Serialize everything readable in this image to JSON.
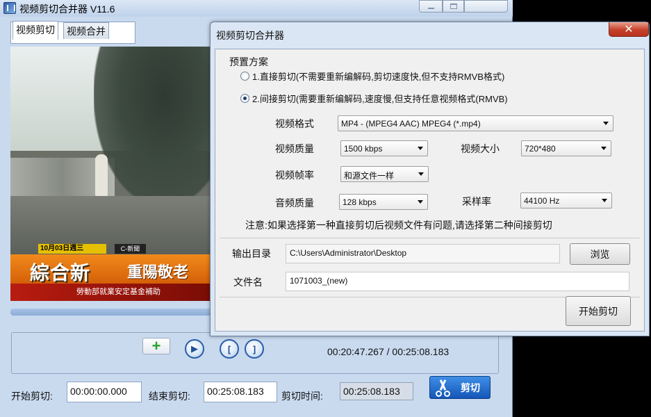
{
  "main_window": {
    "title": "视频剪切合并器 V11.6",
    "tabs": [
      {
        "label": "视频剪切"
      },
      {
        "label": "视频合并"
      }
    ],
    "video_overlay": {
      "date": "10月03日週三",
      "channel": "C-新聞",
      "logo": "綜合新",
      "headline": "重陽敬老",
      "ticker": "勞動部就業安定基金補助"
    },
    "controls": {
      "add_icon": "plus-icon",
      "play_icon": "play-icon",
      "time_display": "00:20:47.267 / 00:25:08.183"
    },
    "cut": {
      "start_label": "开始剪切:",
      "start_value": "00:00:00.000",
      "end_label": "结束剪切:",
      "end_value": "00:25:08.183",
      "duration_label": "剪切时间:",
      "duration_value": "00:25:08.183",
      "button_label": "剪切"
    }
  },
  "dialog": {
    "title": "视频剪切合并器",
    "close_glyph": "✕",
    "preset_label": "预置方案",
    "options": [
      {
        "label": "1.直接剪切(不需要重新编解码,剪切速度快,但不支持RMVB格式)",
        "selected": false
      },
      {
        "label": "2.间接剪切(需要重新编解码,速度慢,但支持任意视频格式(RMVB)",
        "selected": true
      }
    ],
    "fields": {
      "format_label": "视频格式",
      "format_value": "MP4 - (MPEG4 AAC) MPEG4 (*.mp4)",
      "video_quality_label": "视频质量",
      "video_quality_value": "1500 kbps",
      "video_size_label": "视频大小",
      "video_size_value": "720*480",
      "frame_rate_label": "视频帧率",
      "frame_rate_value": "和源文件一样",
      "audio_quality_label": "音频质量",
      "audio_quality_value": "128 kbps",
      "sample_rate_label": "采样率",
      "sample_rate_value": "44100 Hz"
    },
    "note": "注意:如果选择第一种直接剪切后视频文件有问题,请选择第二种间接剪切",
    "output_label": "输出目录",
    "output_value": "C:\\Users\\Administrator\\Desktop",
    "browse_label": "浏览",
    "filename_label": "文件名",
    "filename_value": "1071003_(new)",
    "start_button_label": "开始剪切"
  }
}
